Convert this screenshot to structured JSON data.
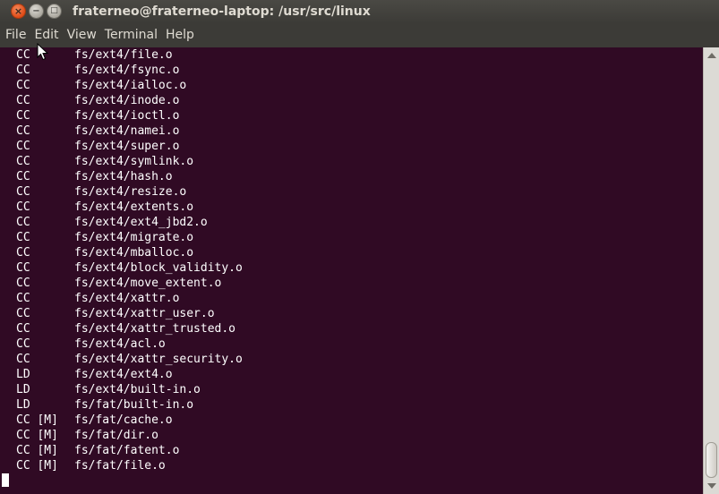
{
  "window": {
    "title": "fraterneo@fraterneo-laptop: /usr/src/linux",
    "buttons": {
      "close": "×",
      "minimize": "−",
      "maximize": "□"
    }
  },
  "menu": [
    "File",
    "Edit",
    "View",
    "Terminal",
    "Help"
  ],
  "terminal": {
    "lines": [
      {
        "action": "CC",
        "path": "fs/ext4/file.o"
      },
      {
        "action": "CC",
        "path": "fs/ext4/fsync.o"
      },
      {
        "action": "CC",
        "path": "fs/ext4/ialloc.o"
      },
      {
        "action": "CC",
        "path": "fs/ext4/inode.o"
      },
      {
        "action": "CC",
        "path": "fs/ext4/ioctl.o"
      },
      {
        "action": "CC",
        "path": "fs/ext4/namei.o"
      },
      {
        "action": "CC",
        "path": "fs/ext4/super.o"
      },
      {
        "action": "CC",
        "path": "fs/ext4/symlink.o"
      },
      {
        "action": "CC",
        "path": "fs/ext4/hash.o"
      },
      {
        "action": "CC",
        "path": "fs/ext4/resize.o"
      },
      {
        "action": "CC",
        "path": "fs/ext4/extents.o"
      },
      {
        "action": "CC",
        "path": "fs/ext4/ext4_jbd2.o"
      },
      {
        "action": "CC",
        "path": "fs/ext4/migrate.o"
      },
      {
        "action": "CC",
        "path": "fs/ext4/mballoc.o"
      },
      {
        "action": "CC",
        "path": "fs/ext4/block_validity.o"
      },
      {
        "action": "CC",
        "path": "fs/ext4/move_extent.o"
      },
      {
        "action": "CC",
        "path": "fs/ext4/xattr.o"
      },
      {
        "action": "CC",
        "path": "fs/ext4/xattr_user.o"
      },
      {
        "action": "CC",
        "path": "fs/ext4/xattr_trusted.o"
      },
      {
        "action": "CC",
        "path": "fs/ext4/acl.o"
      },
      {
        "action": "CC",
        "path": "fs/ext4/xattr_security.o"
      },
      {
        "action": "LD",
        "path": "fs/ext4/ext4.o"
      },
      {
        "action": "LD",
        "path": "fs/ext4/built-in.o"
      },
      {
        "action": "LD",
        "path": "fs/fat/built-in.o"
      },
      {
        "action": "CC [M]",
        "path": "fs/fat/cache.o"
      },
      {
        "action": "CC [M]",
        "path": "fs/fat/dir.o"
      },
      {
        "action": "CC [M]",
        "path": "fs/fat/fatent.o"
      },
      {
        "action": "CC [M]",
        "path": "fs/fat/file.o"
      }
    ]
  },
  "colors": {
    "terminal_bg": "#300a24",
    "text": "#ffffff",
    "chrome_bg": "#3c3b37",
    "close_button": "#df4a16"
  },
  "icons": {
    "close": "close-icon",
    "minimize": "minimize-icon",
    "maximize": "maximize-icon",
    "pointer": "mouse-pointer-icon"
  }
}
